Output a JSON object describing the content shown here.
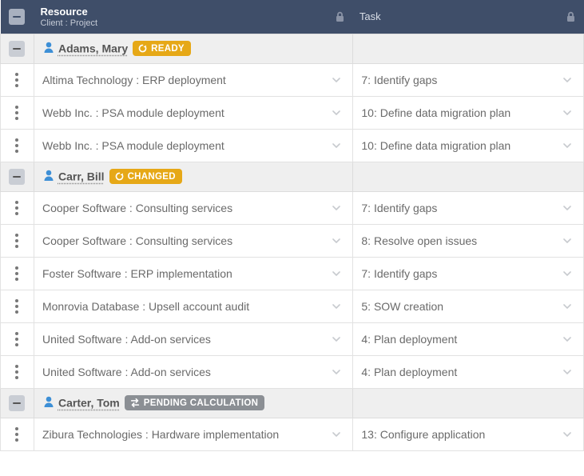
{
  "header": {
    "resource_title": "Resource",
    "resource_sub": "Client : Project",
    "task_title": "Task"
  },
  "badges": {
    "ready": "READY",
    "changed": "CHANGED",
    "pending": "PENDING CALCULATION"
  },
  "groups": [
    {
      "name": "Adams, Mary",
      "status": "ready",
      "rows": [
        {
          "project": "Altima Technology : ERP deployment",
          "task": "7: Identify gaps"
        },
        {
          "project": "Webb Inc. : PSA module deployment",
          "task": "10: Define data migration plan"
        },
        {
          "project": "Webb Inc. : PSA module deployment",
          "task": "10: Define data migration plan"
        }
      ]
    },
    {
      "name": "Carr, Bill",
      "status": "changed",
      "rows": [
        {
          "project": "Cooper Software : Consulting services",
          "task": "7: Identify gaps"
        },
        {
          "project": "Cooper Software : Consulting services",
          "task": "8: Resolve open issues"
        },
        {
          "project": "Foster Software : ERP implementation",
          "task": "7: Identify gaps"
        },
        {
          "project": "Monrovia Database : Upsell account audit",
          "task": "5: SOW creation"
        },
        {
          "project": "United Software : Add-on services",
          "task": "4: Plan deployment"
        },
        {
          "project": "United Software : Add-on services",
          "task": "4: Plan deployment"
        }
      ]
    },
    {
      "name": "Carter, Tom",
      "status": "pending",
      "rows": [
        {
          "project": "Zibura Technologies : Hardware implementation",
          "task": "13: Configure application"
        }
      ]
    }
  ]
}
